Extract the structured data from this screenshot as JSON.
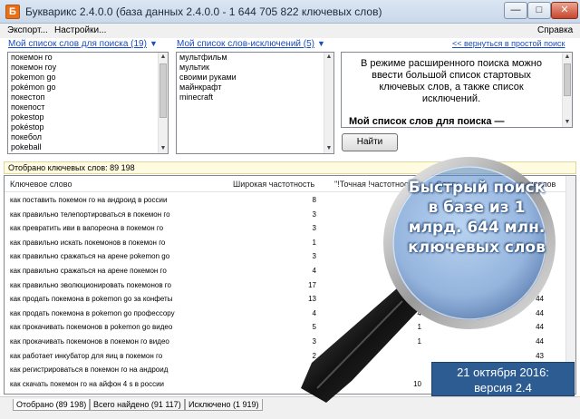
{
  "window": {
    "title": "Букварикс 2.4.0.0 (база данных 2.4.0.0 - 1 644 705 822 ключевых слов)",
    "icon": "app-logo-icon",
    "controls": {
      "minimize": "—",
      "maximize": "□",
      "close": "✕"
    }
  },
  "menu": {
    "export": "Экспорт...",
    "settings": "Настройки...",
    "help": "Справка"
  },
  "search_list": {
    "header": "Мой список слов для поиска (19)",
    "items": [
      "покемон го",
      "покемон гоу",
      "pokemon go",
      "pokémon go",
      "покестоп",
      "покепост",
      "pokestop",
      "pokéstop",
      "покебол",
      "pokeball"
    ]
  },
  "exclude_list": {
    "header": "Мой список слов-исключений (5)",
    "items": [
      "мультфильм",
      "мультик",
      "своими руками",
      "майнкрафт",
      "minecraft"
    ]
  },
  "info": {
    "back_link": "<< вернуться в простой поиск",
    "text": "В режиме расширенного поиска можно ввести большой список стартовых ключевых слов, а также список исключений.",
    "bold_heading": "Мой список слов для поиска —",
    "find_button": "Найти"
  },
  "count_bar": "Отобрано ключевых слов: 89 198",
  "table": {
    "columns": [
      "Ключевое слово",
      "Широкая частотность",
      "\"!Точная !частотность\"",
      "Слов",
      "Символов"
    ],
    "rows": [
      {
        "kw": "как поставить покемон го на андроид в россии",
        "c1": "8",
        "c2": "",
        "c3": ""
      },
      {
        "kw": "как правильно телепортироваться в покемон го",
        "c1": "3",
        "c2": "",
        "c3": ""
      },
      {
        "kw": "как превратить иви в вапореона в покемон го",
        "c1": "3",
        "c2": "",
        "c3": ""
      },
      {
        "kw": "как правильно искать покемонов в покемон го",
        "c1": "1",
        "c2": "",
        "c3": ""
      },
      {
        "kw": "как правильно сражаться на арене pokemon go",
        "c1": "3",
        "c2": "",
        "c3": ""
      },
      {
        "kw": "как правильно сражаться на арене покемон го",
        "c1": "4",
        "c2": "",
        "c3": ""
      },
      {
        "kw": "как правильно эволюционировать покемонов го",
        "c1": "17",
        "c2": "",
        "c3": "43"
      },
      {
        "kw": "как продать покемона в pokemon go за конфеты",
        "c1": "13",
        "c2": "",
        "c3": "44"
      },
      {
        "kw": "как продать покемона в pokemon go профессору",
        "c1": "4",
        "c2": "4",
        "c3": "44"
      },
      {
        "kw": "как прокачивать покемонов в pokemon go видео",
        "c1": "5",
        "c2": "1",
        "c3": "44"
      },
      {
        "kw": "как прокачивать покемонов в покемон го видео",
        "c1": "3",
        "c2": "1",
        "c3": "44"
      },
      {
        "kw": "как работает инкубатор для яиц в покемон го",
        "c1": "2",
        "c2": "",
        "c3": "43"
      },
      {
        "kw": "как регистрироваться в покемон го на андроид",
        "c1": "",
        "c2": "",
        "c3": "44"
      },
      {
        "kw": "как скачать покемон го на айфон 4 s в россии",
        "c1": "",
        "c2": "10",
        "c3": "44"
      }
    ]
  },
  "tabs": [
    "Отобрано (89 198)",
    "Всего найдено (91 117)",
    "Исключено (1 919)"
  ],
  "promo": {
    "text": "Быстрый поиск в базе из 1 млрд. 644 млн. ключевых слов",
    "badge_line1": "21 октября 2016:",
    "badge_line2": "версия 2.4"
  },
  "colors": {
    "accent": "#2d5c93",
    "link": "#1a4dbf",
    "promo_fill": "#ffffff"
  }
}
